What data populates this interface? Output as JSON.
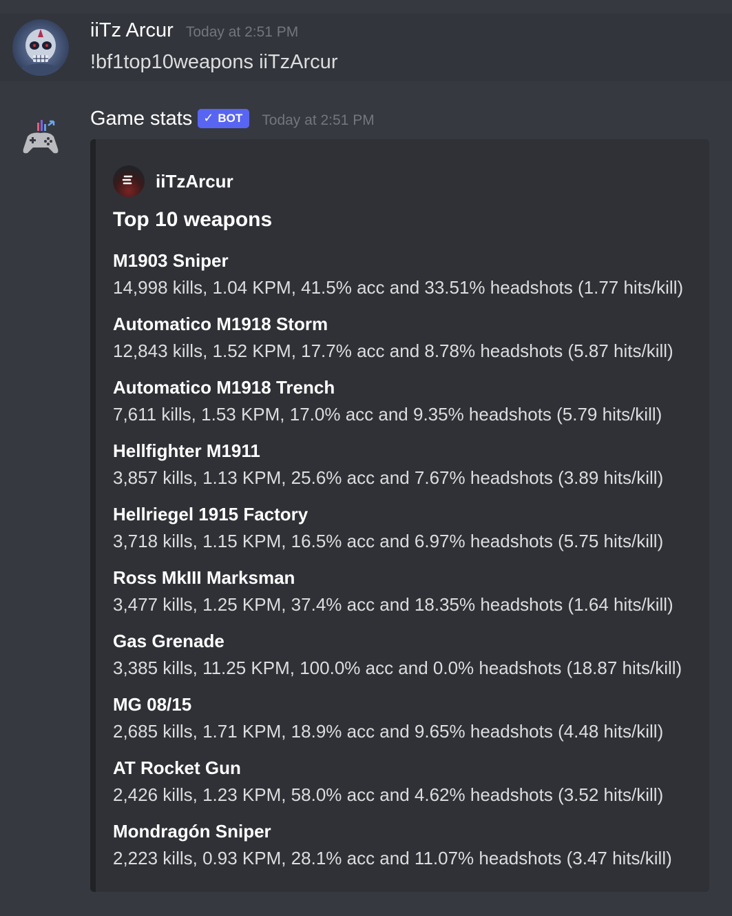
{
  "user_message": {
    "username": "iiTz Arcur",
    "timestamp": "Today at 2:51 PM",
    "content": "!bf1top10weapons iiTzArcur"
  },
  "bot_message": {
    "username": "Game stats",
    "bot_tag": "BOT",
    "timestamp": "Today at 2:51 PM",
    "embed": {
      "author": "iiTzArcur",
      "title": "Top 10 weapons",
      "fields": [
        {
          "name": "M1903 Sniper",
          "value": "14,998 kills, 1.04 KPM, 41.5% acc and 33.51% headshots (1.77 hits/kill)"
        },
        {
          "name": "Automatico M1918 Storm",
          "value": "12,843 kills, 1.52 KPM, 17.7% acc and 8.78% headshots (5.87 hits/kill)"
        },
        {
          "name": "Automatico M1918 Trench",
          "value": "7,611 kills, 1.53 KPM, 17.0% acc and 9.35% headshots (5.79 hits/kill)"
        },
        {
          "name": "Hellfighter M1911",
          "value": "3,857 kills, 1.13 KPM, 25.6% acc and 7.67% headshots (3.89 hits/kill)"
        },
        {
          "name": "Hellriegel 1915 Factory",
          "value": "3,718 kills, 1.15 KPM, 16.5% acc and 6.97% headshots (5.75 hits/kill)"
        },
        {
          "name": "Ross MkIII Marksman",
          "value": "3,477 kills, 1.25 KPM, 37.4% acc and 18.35% headshots (1.64 hits/kill)"
        },
        {
          "name": "Gas Grenade",
          "value": "3,385 kills, 11.25 KPM, 100.0% acc and 0.0% headshots (18.87 hits/kill)"
        },
        {
          "name": "MG 08/15",
          "value": "2,685 kills, 1.71 KPM, 18.9% acc and 9.65% headshots (4.48 hits/kill)"
        },
        {
          "name": "AT Rocket Gun",
          "value": "2,426 kills, 1.23 KPM, 58.0% acc and 4.62% headshots (3.52 hits/kill)"
        },
        {
          "name": "Mondragón Sniper",
          "value": "2,223 kills, 0.93 KPM, 28.1% acc and 11.07% headshots (3.47 hits/kill)"
        }
      ]
    }
  },
  "colors": {
    "background": "#36393f",
    "embed_background": "#2f3136",
    "bot_tag": "#5865f2",
    "timestamp": "#72767d"
  },
  "icons": {
    "user_avatar": "skull-avatar-icon",
    "bot_avatar": "gamepad-icon",
    "embed_author": "bf1-logo-icon",
    "bot_verified": "checkmark-icon"
  }
}
